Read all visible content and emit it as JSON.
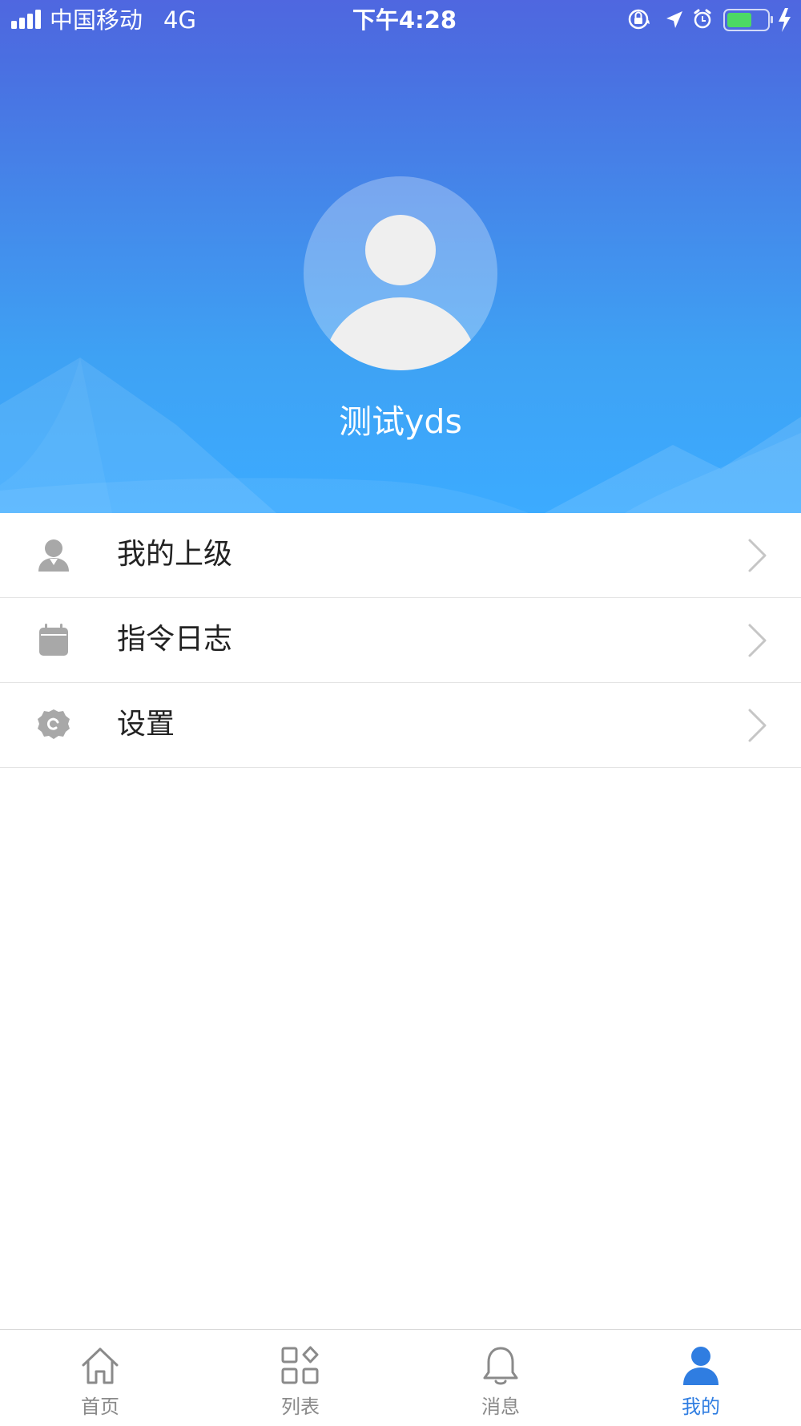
{
  "status_bar": {
    "carrier": "中国移动",
    "network": "4G",
    "time": "下午4:28",
    "battery_color": "#4cd964"
  },
  "profile": {
    "username": "测试yds",
    "avatar_icon": "default-avatar-icon"
  },
  "menu": {
    "items": [
      {
        "label": "我的上级",
        "icon": "supervisor-user-icon"
      },
      {
        "label": "指令日志",
        "icon": "calendar-icon"
      },
      {
        "label": "设置",
        "icon": "settings-gear-icon"
      }
    ]
  },
  "tabbar": {
    "tabs": [
      {
        "label": "首页",
        "icon": "home-icon",
        "active": false
      },
      {
        "label": "列表",
        "icon": "grid-list-icon",
        "active": false
      },
      {
        "label": "消息",
        "icon": "bell-icon",
        "active": false
      },
      {
        "label": "我的",
        "icon": "user-icon",
        "active": true
      }
    ]
  },
  "colors": {
    "accent": "#2f7de1",
    "header_top": "#4f67e0",
    "header_bottom": "#3cabff",
    "icon_gray": "#a8a8a8",
    "tab_inactive": "#8a8a8a"
  }
}
